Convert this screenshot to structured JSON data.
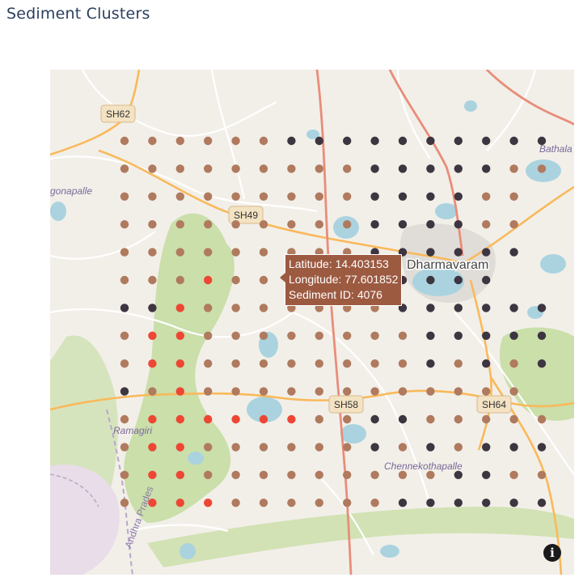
{
  "page": {
    "title": "Sediment Clusters"
  },
  "map": {
    "place_labels": {
      "dharmavaram": "Dharmavaram",
      "ramagiri": "Ramagiri",
      "chennekothapalle": "Chennekothapalle",
      "bathala": "Bathala",
      "gonapalle": "gonapalle",
      "andhra_pradesh": "Andhra Prades"
    },
    "road_shields": {
      "sh62": "SH62",
      "sh49": "SH49",
      "sh58": "SH58",
      "sh64": "SH64"
    },
    "colors": {
      "land": "#f2efe9",
      "park": "#cadfaa",
      "water": "#aad3df",
      "state_road": "#f9b95a",
      "primary_road": "#e98d7a",
      "minor_road": "#ffffff",
      "border": "#b8a7c8"
    }
  },
  "chart_data": {
    "type": "scatter",
    "title": "Sediment Clusters",
    "clusters": [
      {
        "id": 0,
        "color": "#b07a5e"
      },
      {
        "id": 1,
        "color": "#3d3540"
      },
      {
        "id": 2,
        "color": "#ee4635"
      }
    ],
    "grid_rows": [
      "0000001111111111",
      "0000000001111100",
      "000000000111100",
      "000000000111100",
      "000000000111111",
      "00020000111111",
      "1120000000111111",
      "0220000000011111",
      "0220000000010101",
      "102000000000000",
      "0222222001100000",
      "0220000001010111",
      "0220000000001100",
      "0222000000111111"
    ]
  },
  "tooltip": {
    "latitude": "Latitude: 14.403153",
    "longitude": "Longitude: 77.601852",
    "sediment_id": "Sediment ID: 4076"
  },
  "controls": {
    "info_label": "i"
  }
}
